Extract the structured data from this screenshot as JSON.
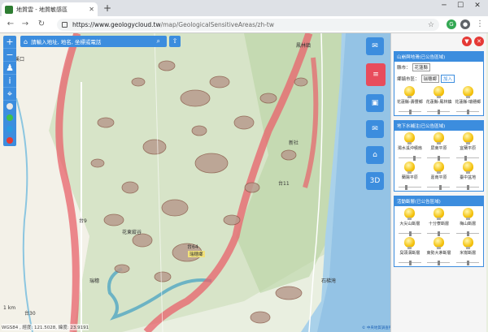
{
  "browser": {
    "tab_title": "地質雲 - 地質敏感區",
    "url_host": "https://www.geologycloud.tw",
    "url_path": "/map/GeologicalSensitiveAreas/zh-tw",
    "icons": [
      "back-icon",
      "forward-icon",
      "reload-icon",
      "lock-icon",
      "star-icon",
      "menu-icon"
    ]
  },
  "map": {
    "search_placeholder": "請輸入地址, 地名, 坐標或電話",
    "scale_label": "1 km",
    "coords": "WGS84 , 經度: 121.5028, 緯度: 23.9191",
    "attribution": "© 中央地質調查所 | Map data © 內政部國土測繪中心",
    "labels": {
      "l1": "溪口",
      "l2": "鳳林鎮",
      "l3": "台9",
      "l4": "台64",
      "l5": "瑞穗鄉",
      "l6": "花東縱谷",
      "l7": "瑞穗",
      "l8": "台11",
      "l9": "新社",
      "l10": "台30",
      "l11": "石梯灣"
    },
    "tools": [
      "chat-icon",
      "layers-icon",
      "photo-icon",
      "mail-icon",
      "factory-icon",
      "3d-icon"
    ],
    "tool_3d_label": "3D"
  },
  "panel": {
    "cards": [
      {
        "title": "山崩與地滑(已公告區域)",
        "county_label": "縣市：",
        "county_value": "花蓮縣",
        "town_label": "鄉鎮市區：",
        "town_value": "瑞穗鄉",
        "add_label": "加入",
        "items": [
          {
            "label": "花蓮縣-壽豐鄉",
            "level": 0.5
          },
          {
            "label": "花蓮縣-鳳林鎮",
            "level": 0.5
          },
          {
            "label": "花蓮縣-瑞穗鄉",
            "level": 0.5
          }
        ]
      },
      {
        "title": "地下水補注(已公告區域)",
        "items": [
          {
            "label": "濁水溪沖積扇",
            "level": 0.7
          },
          {
            "label": "屏東平原",
            "level": 0.5
          },
          {
            "label": "宜蘭平原",
            "level": 0.4
          },
          {
            "label": "蘭陽平原",
            "level": 0.3
          },
          {
            "label": "嘉南平原",
            "level": 0.6
          },
          {
            "label": "臺中盆地",
            "level": 0.5
          }
        ]
      },
      {
        "title": "活動斷層(已公告區域)",
        "items": [
          {
            "label": "大尖山斷層",
            "level": 0.5
          },
          {
            "label": "十分寮斷層",
            "level": 0.5
          },
          {
            "label": "梅山斷層",
            "level": 0.5
          },
          {
            "label": "臭頭溝斷層",
            "level": 0.5
          },
          {
            "label": "東勢大茅斷層",
            "level": 0.5
          },
          {
            "label": "米崙斷層",
            "level": 0.5
          }
        ]
      }
    ]
  }
}
